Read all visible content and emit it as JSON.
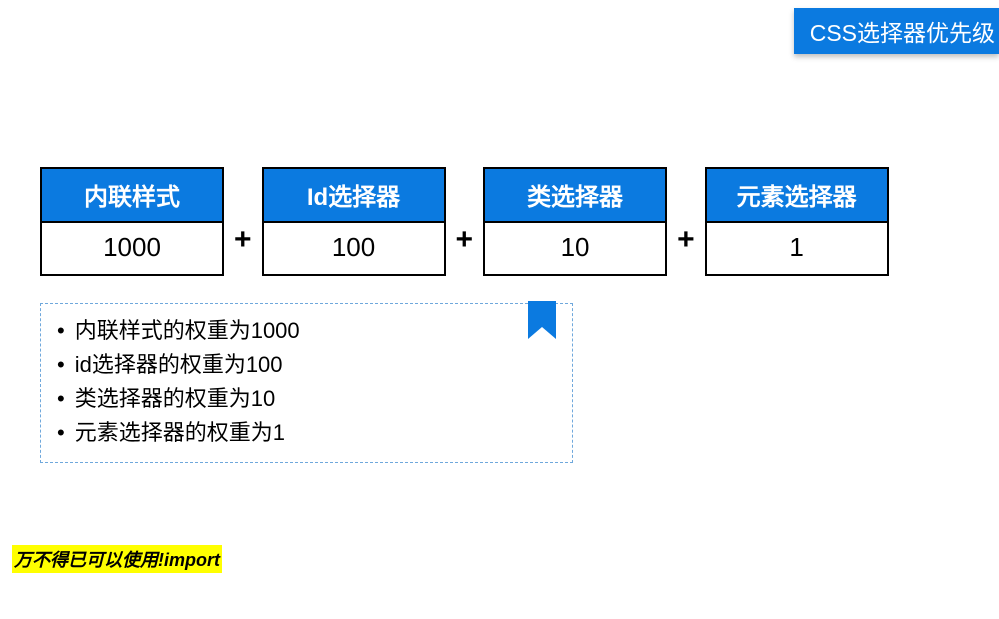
{
  "title": "CSS选择器优先级",
  "weights": [
    {
      "label": "内联样式",
      "value": "1000"
    },
    {
      "label": "Id选择器",
      "value": "100"
    },
    {
      "label": "类选择器",
      "value": "10"
    },
    {
      "label": "元素选择器",
      "value": "1"
    }
  ],
  "plus": "+",
  "notes": [
    "内联样式的权重为1000",
    "id选择器的权重为100",
    "类选择器的权重为10",
    "元素选择器的权重为1"
  ],
  "footnote": "万不得已可以使用!import",
  "chart_data": {
    "type": "table",
    "title": "CSS选择器优先级",
    "categories": [
      "内联样式",
      "Id选择器",
      "类选择器",
      "元素选择器"
    ],
    "values": [
      1000,
      100,
      10,
      1
    ]
  }
}
